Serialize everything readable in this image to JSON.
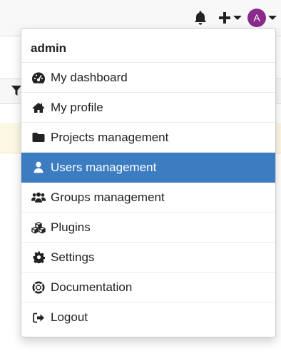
{
  "topbar": {
    "avatar_initial": "A",
    "icons": [
      "bell-icon",
      "plus-icon",
      "caret-down-icon",
      "avatar",
      "caret-down-icon"
    ]
  },
  "colors": {
    "avatar_bg": "#8a2a8a",
    "active_item_bg": "#3c7cc1",
    "highlight_row_bg": "#fdf8e4"
  },
  "menu": {
    "header": "admin",
    "items": [
      {
        "label": "My dashboard",
        "icon": "dashboard-icon",
        "active": false
      },
      {
        "label": "My profile",
        "icon": "home-icon",
        "active": false
      },
      {
        "label": "Projects management",
        "icon": "folder-icon",
        "active": false
      },
      {
        "label": "Users management",
        "icon": "user-icon",
        "active": true
      },
      {
        "label": "Groups management",
        "icon": "users-icon",
        "active": false
      },
      {
        "label": "Plugins",
        "icon": "cubes-icon",
        "active": false
      },
      {
        "label": "Settings",
        "icon": "gear-icon",
        "active": false
      },
      {
        "label": "Documentation",
        "icon": "life-ring-icon",
        "active": false
      },
      {
        "label": "Logout",
        "icon": "sign-out-icon",
        "active": false
      }
    ]
  }
}
